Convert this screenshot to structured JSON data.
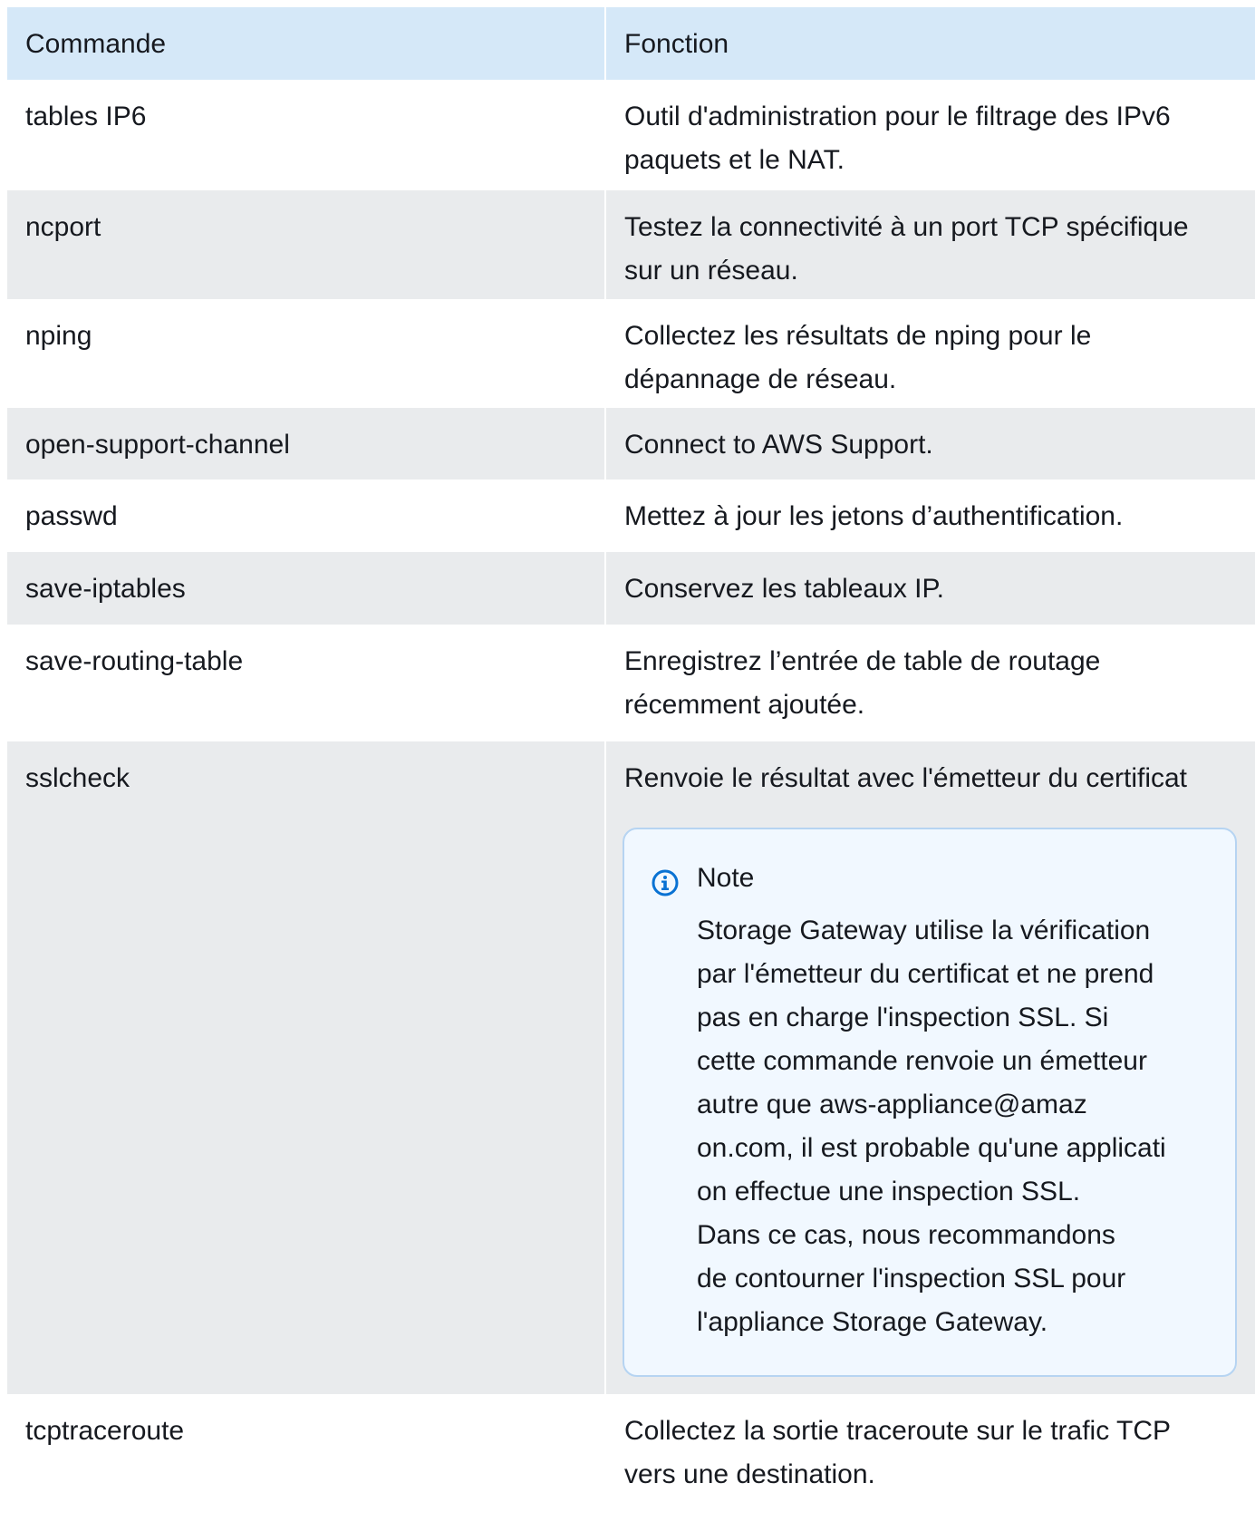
{
  "table": {
    "headers": [
      "Commande",
      "Fonction"
    ],
    "rows": [
      {
        "command": "tables IP6",
        "function_lines": [
          "Outil d'administration pour le filtrage des IPv6",
          "paquets et le NAT."
        ]
      },
      {
        "command": "ncport",
        "function_lines": [
          "Testez la connectivité à un port TCP spécifique",
          "sur un réseau."
        ]
      },
      {
        "command": "nping",
        "function_lines": [
          "Collectez les résultats de nping pour le",
          "dépannage de réseau."
        ]
      },
      {
        "command": "open-support-channel",
        "function_lines": [
          "Connect to AWS Support."
        ]
      },
      {
        "command": "passwd",
        "function_lines": [
          "Mettez à jour les jetons d’authentification."
        ]
      },
      {
        "command": "save-iptables",
        "function_lines": [
          "Conservez les tableaux IP."
        ]
      },
      {
        "command": "save-routing-table",
        "function_lines": [
          "Enregistrez l’entrée de table de routage",
          "récemment ajoutée."
        ]
      },
      {
        "command": "sslcheck",
        "function_lines": [
          "Renvoie le résultat avec l'émetteur du certificat"
        ]
      },
      {
        "command": "tcptraceroute",
        "function_lines": [
          "Collectez la sortie traceroute sur le trafic TCP",
          "vers une destination."
        ]
      }
    ]
  },
  "note": {
    "title": "Note",
    "icon": "info-icon",
    "lines": [
      "Storage Gateway utilise la vérification",
      "par l'émetteur du certificat et ne prend",
      "pas en charge l'inspection SSL. Si",
      "cette commande renvoie un émetteur",
      "autre que aws-appliance@amaz",
      "on.com, il est probable qu'une applicati",
      "on effectue une inspection SSL.",
      "Dans ce cas, nous recommandons",
      "de contourner l'inspection SSL pour",
      "l'appliance Storage Gateway."
    ]
  },
  "colors": {
    "header_bg": "#d5e8f8",
    "row_alt_bg": "#e9ebed",
    "note_bg": "#f1f8ff",
    "note_border": "#b6d4f2",
    "info_icon": "#0972d3"
  }
}
